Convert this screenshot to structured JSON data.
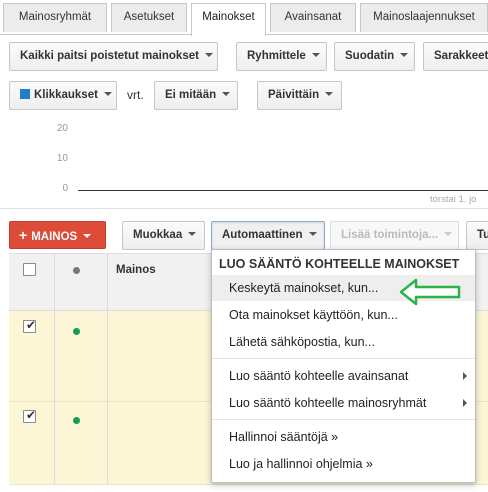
{
  "tabs": [
    {
      "label": "Mainosryhmät"
    },
    {
      "label": "Asetukset"
    },
    {
      "label": "Mainokset"
    },
    {
      "label": "Avainsanat"
    },
    {
      "label": "Mainoslaajennukset"
    }
  ],
  "toolbar1": {
    "filter": "Kaikki paitsi poistetut mainokset",
    "group": "Ryhmittele",
    "filters": "Suodatin",
    "columns": "Sarakkeet"
  },
  "toolbar_chart": {
    "metric1": "Klikkaukset",
    "vs_label": "vrt.",
    "metric2": "Ei mitään",
    "period": "Päivittäin",
    "metric1_color": "#1f7fc8"
  },
  "chart_data": {
    "type": "line",
    "y_ticks": [
      "20",
      "10",
      "0"
    ],
    "x_label_partial": "torstai 1. jo",
    "series": [
      {
        "values": [
          0
        ]
      }
    ],
    "ylim": [
      0,
      20
    ]
  },
  "toolbar2": {
    "add_ad": "MAINOS",
    "edit": "Muokkaa",
    "automation": "Automaattinen",
    "more_actions": "Lisää toimintoja...",
    "partial": "Tu"
  },
  "table": {
    "col_ad": "Mainos",
    "rows": [
      {
        "checked": true,
        "status_color": "#0f9d58"
      },
      {
        "checked": true,
        "status_color": "#0f9d58"
      }
    ]
  },
  "menu": {
    "header": "LUO SÄÄNTÖ KOHTEELLE MAINOKSET",
    "items": [
      {
        "label": "Keskeytä mainokset, kun..."
      },
      {
        "label": "Ota mainokset käyttöön, kun..."
      },
      {
        "label": "Lähetä sähköpostia, kun..."
      },
      {
        "label": "Luo sääntö kohteelle avainsanat"
      },
      {
        "label": "Luo sääntö kohteelle mainosryhmät"
      },
      {
        "label": "Hallinnoi sääntöjä »"
      },
      {
        "label": "Luo ja hallinnoi ohjelmia »"
      }
    ]
  },
  "colors": {
    "accent_red": "#dd4b39",
    "highlight_row": "#fdf6d6",
    "annotation_green": "#2db24a"
  }
}
